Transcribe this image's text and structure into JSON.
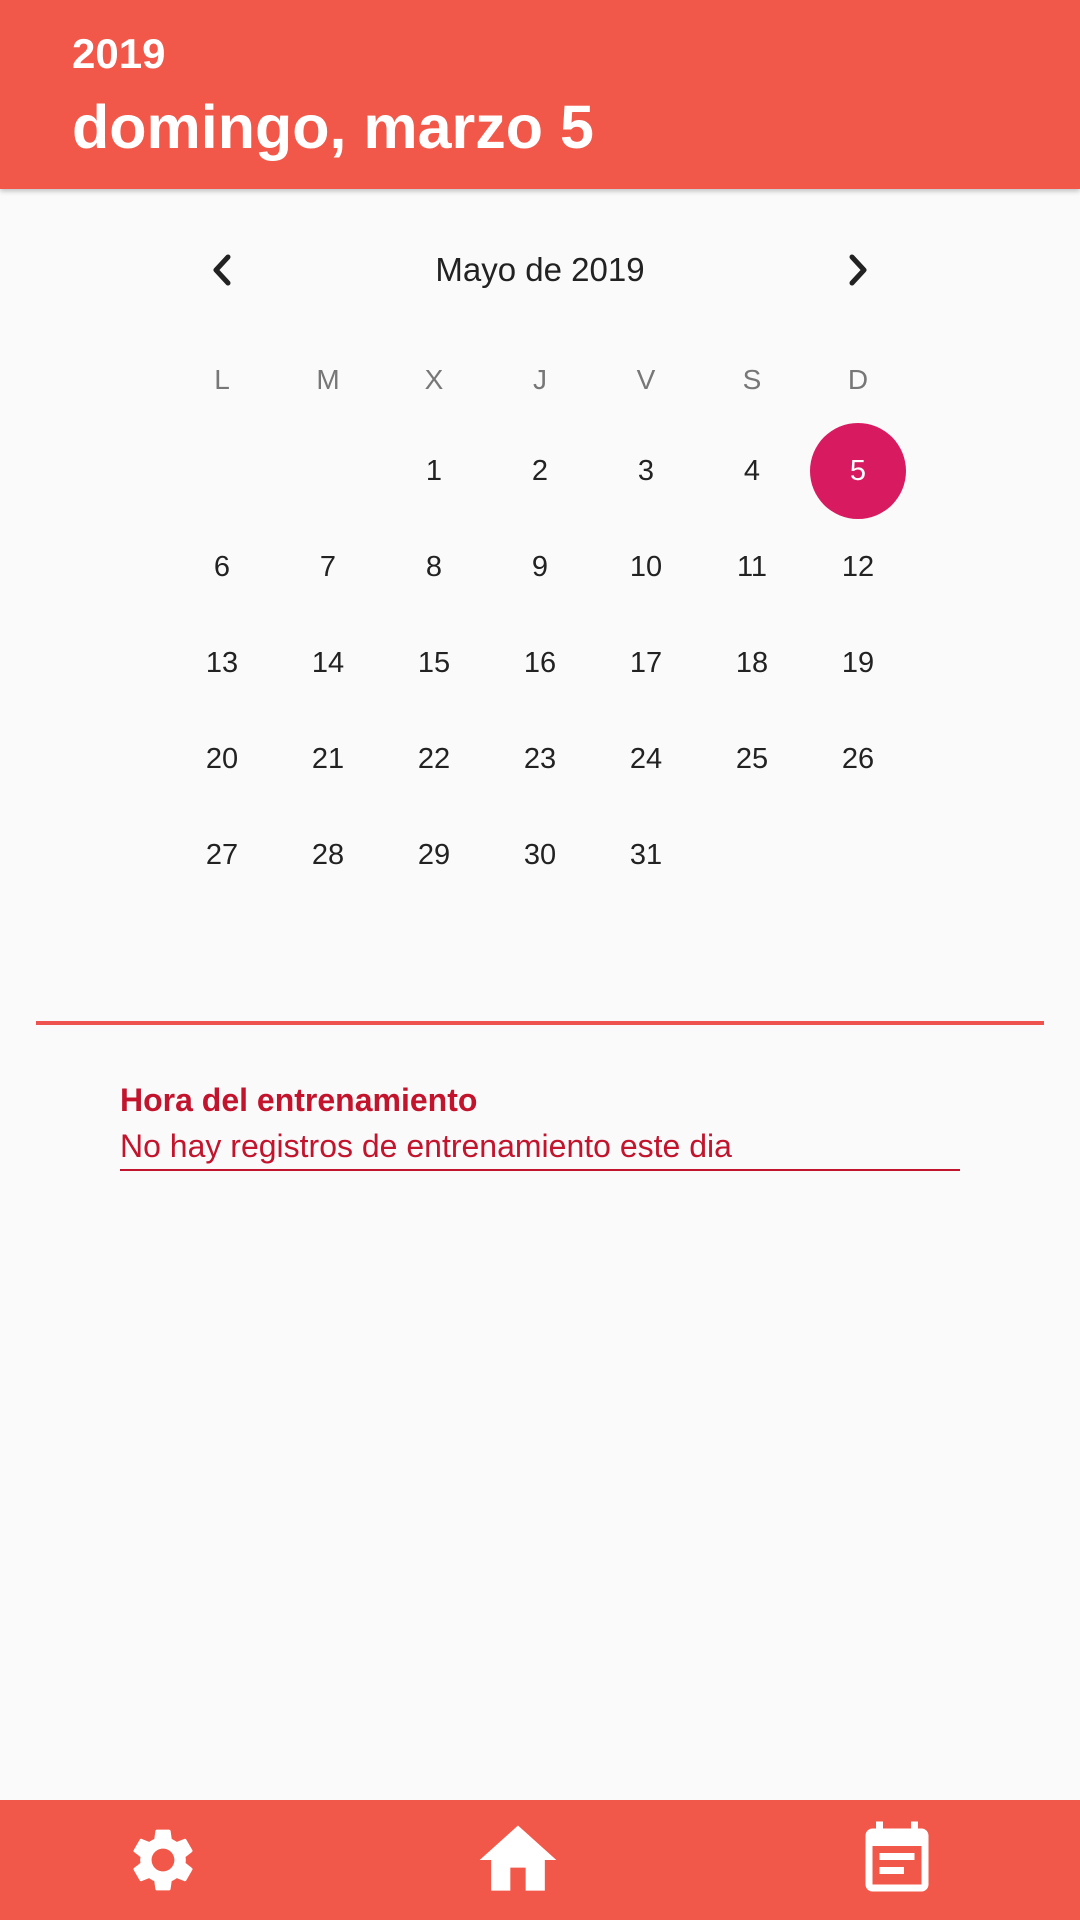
{
  "header": {
    "year": "2019",
    "date": "domingo, marzo 5"
  },
  "calendar": {
    "month_title": "Mayo de 2019",
    "weekdays": [
      "L",
      "M",
      "X",
      "J",
      "V",
      "S",
      "D"
    ],
    "days": [
      "1",
      "2",
      "3",
      "4",
      "5",
      "6",
      "7",
      "8",
      "9",
      "10",
      "11",
      "12",
      "13",
      "14",
      "15",
      "16",
      "17",
      "18",
      "19",
      "20",
      "21",
      "22",
      "23",
      "24",
      "25",
      "26",
      "27",
      "28",
      "29",
      "30",
      "31"
    ],
    "selected_day": "5",
    "accent_color": "#d81b60"
  },
  "training": {
    "label": "Hora del entrenamiento",
    "value": "No hay registros de entrenamiento este dia"
  },
  "bottom_nav": {
    "items": [
      "gear-icon",
      "home-icon",
      "calendar-icon"
    ]
  },
  "colors": {
    "primary": "#f2584a",
    "text_accent": "#c2142d"
  }
}
